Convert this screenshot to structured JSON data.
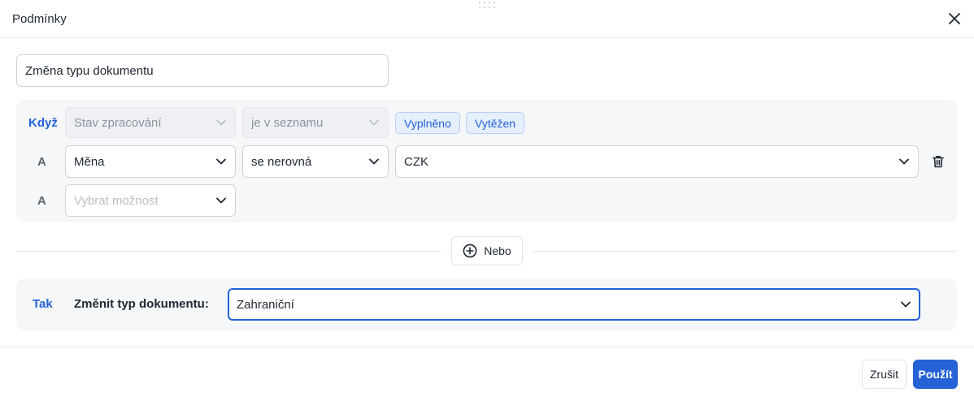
{
  "dialog": {
    "title": "Podmínky"
  },
  "rule": {
    "name_value": "Změna typu dokumentu"
  },
  "conditions": {
    "when_label": "Když",
    "and_label": "A",
    "row1": {
      "field": "Stav zpracování",
      "operator": "je v seznamu",
      "values": [
        "Vyplněno",
        "Vytěžen"
      ]
    },
    "row2": {
      "field": "Měna",
      "operator": "se nerovná",
      "value": "CZK"
    },
    "row3": {
      "placeholder": "Vybrat možnost"
    }
  },
  "or_button": {
    "label": "Nebo"
  },
  "action": {
    "then_label": "Tak",
    "text": "Změnit typ dokumentu:",
    "value": "Zahraniční"
  },
  "footer": {
    "cancel_label": "Zrušit",
    "apply_label": "Použít"
  },
  "colors": {
    "accent": "#2462d6",
    "panel": "#f5f7f9"
  }
}
